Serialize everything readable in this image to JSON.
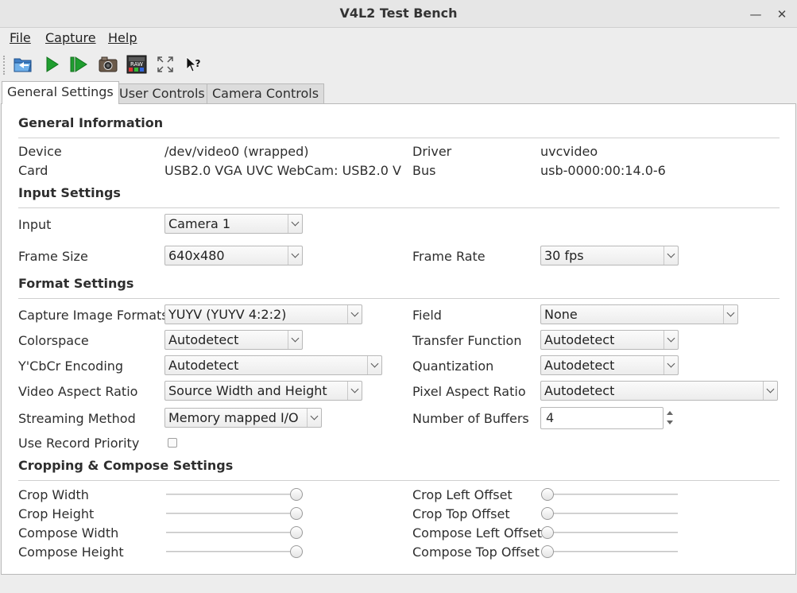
{
  "window": {
    "title": "V4L2 Test Bench",
    "minimize_glyph": "—",
    "close_glyph": "✕"
  },
  "menu": {
    "file": "File",
    "capture": "Capture",
    "help": "Help"
  },
  "toolbar": {
    "icons": [
      "open-folder-icon",
      "play-icon",
      "step-play-icon",
      "snapshot-camera-icon",
      "raw-icon",
      "fullscreen-icon",
      "whats-this-icon"
    ],
    "raw_text": "RAW"
  },
  "tabs": {
    "general": "General Settings",
    "user": "User Controls",
    "camera": "Camera Controls"
  },
  "general_info": {
    "heading": "General Information",
    "device_label": "Device",
    "device_value": "/dev/video0 (wrapped)",
    "card_label": "Card",
    "card_value": "USB2.0 VGA UVC WebCam: USB2.0 V",
    "driver_label": "Driver",
    "driver_value": "uvcvideo",
    "bus_label": "Bus",
    "bus_value": "usb-0000:00:14.0-6"
  },
  "input_settings": {
    "heading": "Input Settings",
    "input_label": "Input",
    "input_value": "Camera 1",
    "frame_size_label": "Frame Size",
    "frame_size_value": "640x480",
    "frame_rate_label": "Frame Rate",
    "frame_rate_value": "30 fps"
  },
  "format_settings": {
    "heading": "Format Settings",
    "capture_formats_label": "Capture Image Formats",
    "capture_formats_value": "YUYV (YUYV 4:2:2)",
    "field_label": "Field",
    "field_value": "None",
    "colorspace_label": "Colorspace",
    "colorspace_value": "Autodetect",
    "transfer_label": "Transfer Function",
    "transfer_value": "Autodetect",
    "ycbcr_label": "Y'CbCr Encoding",
    "ycbcr_value": "Autodetect",
    "quantization_label": "Quantization",
    "quantization_value": "Autodetect",
    "video_aspect_label": "Video Aspect Ratio",
    "video_aspect_value": "Source Width and Height",
    "pixel_aspect_label": "Pixel Aspect Ratio",
    "pixel_aspect_value": "Autodetect",
    "streaming_label": "Streaming Method",
    "streaming_value": "Memory mapped I/O",
    "buffers_label": "Number of Buffers",
    "buffers_value": "4",
    "record_priority_label": "Use Record Priority",
    "record_priority_checked": false
  },
  "crop_settings": {
    "heading": "Cropping & Compose Settings",
    "crop_width_label": "Crop Width",
    "crop_width_level": 1.0,
    "crop_height_label": "Crop Height",
    "crop_height_level": 1.0,
    "compose_width_label": "Compose Width",
    "compose_width_level": 1.0,
    "compose_height_label": "Compose Height",
    "compose_height_level": 1.0,
    "crop_left_label": "Crop Left Offset",
    "crop_left_level": 0.0,
    "crop_top_label": "Crop Top Offset",
    "crop_top_level": 0.0,
    "compose_left_label": "Compose Left Offset",
    "compose_left_level": 0.0,
    "compose_top_label": "Compose Top Offset",
    "compose_top_level": 0.0
  }
}
